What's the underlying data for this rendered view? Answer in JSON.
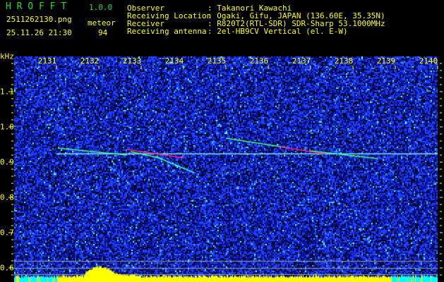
{
  "app": {
    "name": "H R O F F T",
    "version": "1.0.0"
  },
  "file": {
    "name": "2511262130.png",
    "datetime": "25.11.26 21:30"
  },
  "meteor": {
    "label": "meteor",
    "count": "94"
  },
  "info": [
    {
      "label": "Observer",
      "value": ": Takanori Kawachi"
    },
    {
      "label": "Receiving Location",
      "value": ": Ogaki, Gifu, JAPAN (136.60E, 35.35N)"
    },
    {
      "label": "Receiver",
      "value": ": R820T2(RTL-SDR) SDR-Sharp 53.1000MHz"
    },
    {
      "label": "Receiving antenna",
      "value": ": 2el-HB9CV Vertical (el. E-W)"
    }
  ],
  "chart_data": {
    "type": "heatmap",
    "ylabel": "kHz",
    "x_ticks": [
      "2131",
      "2132",
      "2133",
      "2134",
      "2135",
      "2136",
      "2137",
      "2138",
      "2139",
      "2140"
    ],
    "y_ticks": [
      "1.1",
      "1.0",
      "0.9",
      "0.8",
      "0.7",
      "0.6"
    ],
    "ylim": [
      0.57,
      1.2
    ],
    "carrier_khz": 0.925,
    "colors": {
      "background": "#0a14a0",
      "noise": "#2040ff",
      "carrier": "#80e0ff",
      "signal": "#ff2080",
      "histogram": "#ffff00",
      "histogram_low": "#00ffff",
      "text": "#ffff00",
      "title": "#22dd22"
    }
  }
}
